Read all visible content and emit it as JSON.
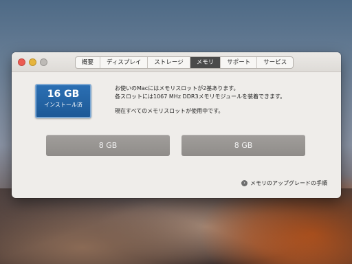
{
  "tabs": [
    {
      "label": "概要"
    },
    {
      "label": "ディスプレイ"
    },
    {
      "label": "ストレージ"
    },
    {
      "label": "メモリ"
    },
    {
      "label": "サポート"
    },
    {
      "label": "サービス"
    }
  ],
  "active_tab": "メモリ",
  "memory": {
    "total": "16 GB",
    "installed_label": "インストール済"
  },
  "info": {
    "line1": "お使いのMacにはメモリスロットが2基あります。",
    "line2": "各スロットには1067 MHz DDR3メモリモジュールを装着できます。",
    "line3": "現在すべてのメモリスロットが使用中です。"
  },
  "slots": [
    {
      "size": "8 GB"
    },
    {
      "size": "8 GB"
    }
  ],
  "upgrade_link": "メモリのアップグレードの手順",
  "colors": {
    "memory_box": "#1d5996",
    "active_tab": "#4a4a4a",
    "slot": "#8f8c89"
  }
}
